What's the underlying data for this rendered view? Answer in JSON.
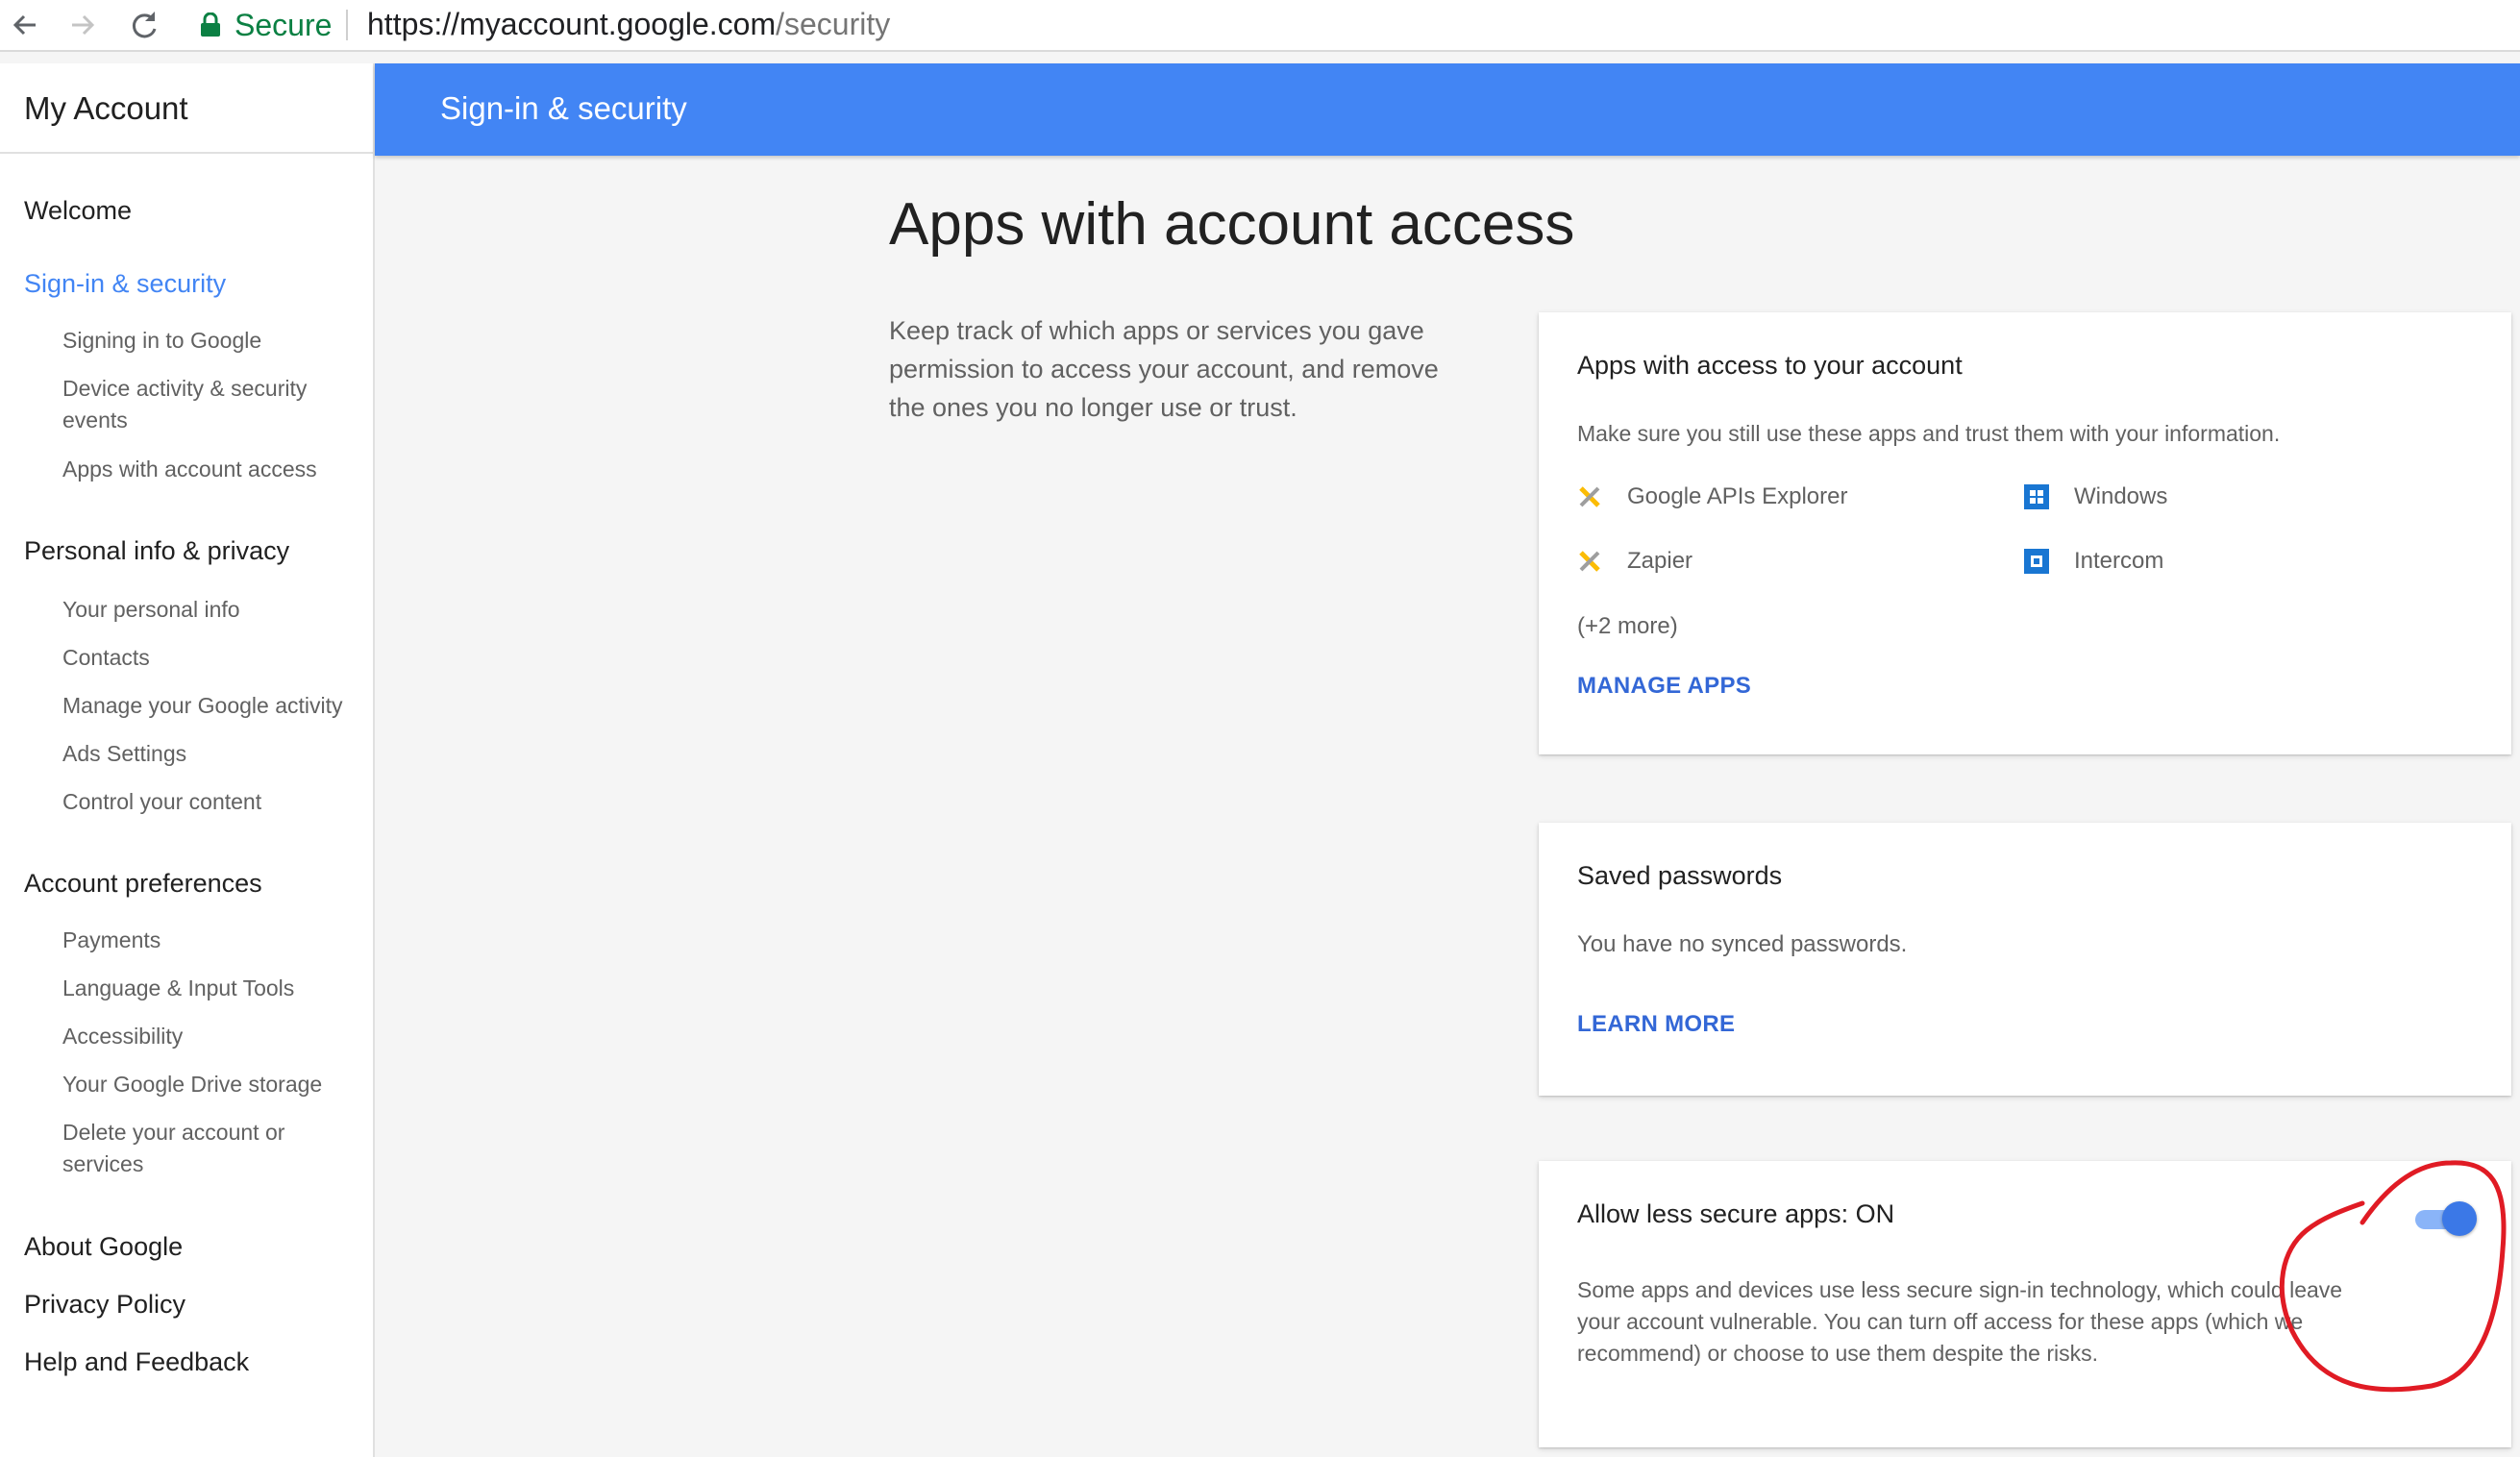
{
  "browser": {
    "secure_label": "Secure",
    "url_host": "https://myaccount.google.com",
    "url_path": "/security",
    "icons": [
      "back-arrow-icon",
      "forward-arrow-icon",
      "reload-icon",
      "lock-icon"
    ]
  },
  "sidebar": {
    "title": "My Account",
    "welcome": "Welcome",
    "sections": [
      {
        "label": "Sign-in & security",
        "items": [
          "Signing in to Google",
          "Device activity & security events",
          "Apps with account access"
        ]
      },
      {
        "label": "Personal info & privacy",
        "items": [
          "Your personal info",
          "Contacts",
          "Manage your Google activity",
          "Ads Settings",
          "Control your content"
        ]
      },
      {
        "label": "Account preferences",
        "items": [
          "Payments",
          "Language & Input Tools",
          "Accessibility",
          "Your Google Drive storage",
          "Delete your account or services"
        ]
      }
    ],
    "footer_links": [
      "About Google",
      "Privacy Policy",
      "Help and Feedback"
    ]
  },
  "header": {
    "title": "Sign-in & security"
  },
  "main": {
    "title": "Apps with account access",
    "description": "Keep track of which apps or services you gave permission to access your account, and remove the ones you no longer use or trust.",
    "apps_card": {
      "title": "Apps with access to your account",
      "subtitle": "Make sure you still use these apps and trust them with your information.",
      "apps": [
        {
          "name": "Google APIs Explorer",
          "icon": "api-explorer-icon"
        },
        {
          "name": "Windows",
          "icon": "windows-icon"
        },
        {
          "name": "Zapier",
          "icon": "zapier-icon"
        },
        {
          "name": "Intercom",
          "icon": "intercom-icon"
        }
      ],
      "more": "(+2 more)",
      "action": "MANAGE APPS"
    },
    "passwords_card": {
      "title": "Saved passwords",
      "text": "You have no synced passwords.",
      "action": "LEARN MORE"
    },
    "less_secure_card": {
      "title": "Allow less secure apps: ON",
      "text": "Some apps and devices use less secure sign-in technology, which could leave your account vulnerable. You can turn off access for these apps (which we recommend) or choose to use them despite the risks.",
      "toggle_on": true
    }
  },
  "colors": {
    "accent": "#4285f4",
    "link": "#3367d6",
    "secure_green": "#0b8043",
    "annotation_red": "#e01b24"
  }
}
